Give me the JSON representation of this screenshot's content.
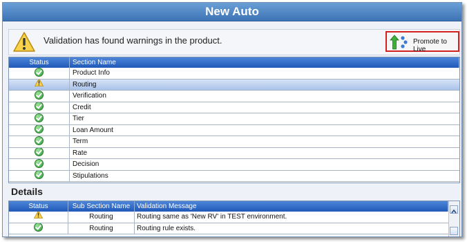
{
  "window": {
    "title": "New Auto"
  },
  "warning": {
    "message": "Validation has found warnings in the product."
  },
  "promote": {
    "label": "Promote to Live"
  },
  "sections": {
    "headers": {
      "status": "Status",
      "name": "Section Name"
    },
    "rows": [
      {
        "status": "ok",
        "name": "Product Info"
      },
      {
        "status": "warning",
        "name": "Routing"
      },
      {
        "status": "ok",
        "name": "Verification"
      },
      {
        "status": "ok",
        "name": "Credit"
      },
      {
        "status": "ok",
        "name": "Tier"
      },
      {
        "status": "ok",
        "name": "Loan Amount"
      },
      {
        "status": "ok",
        "name": "Term"
      },
      {
        "status": "ok",
        "name": "Rate"
      },
      {
        "status": "ok",
        "name": "Decision"
      },
      {
        "status": "ok",
        "name": "Stipulations"
      }
    ]
  },
  "details": {
    "title": "Details",
    "headers": {
      "status": "Status",
      "sub": "Sub Section Name",
      "msg": "Validation Message"
    },
    "rows": [
      {
        "status": "warning",
        "sub": "Routing",
        "msg": "Routing same as 'New RV' in TEST environment."
      },
      {
        "status": "ok",
        "sub": "Routing",
        "msg": "Routing rule exists."
      }
    ]
  },
  "colors": {
    "title_bar": "#3d73b4",
    "grid_header": "#1f58b8",
    "selected_row": "#c2d5f2",
    "promote_border": "#d32020"
  },
  "icons": {
    "warning": "warning-triangle-icon",
    "ok": "green-check-icon",
    "promote": "promote-arrow-icon"
  }
}
